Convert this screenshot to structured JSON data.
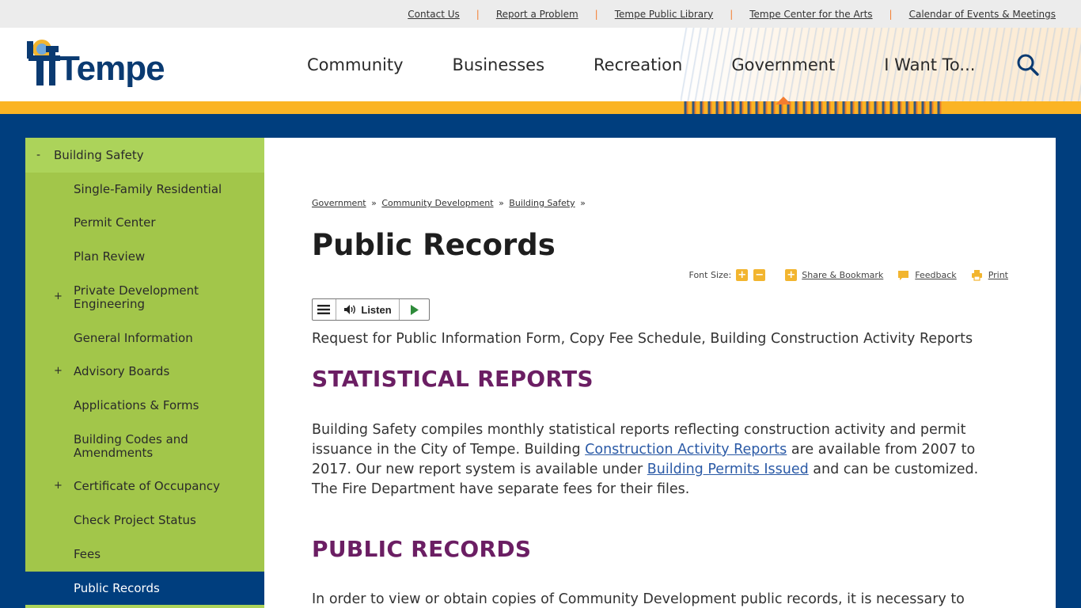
{
  "utility_nav": [
    "Contact Us",
    "Report a Problem",
    "Tempe Public Library",
    "Tempe Center for the Arts",
    "Calendar of Events & Meetings"
  ],
  "logo": {
    "text": "Tempe"
  },
  "main_nav": [
    "Community",
    "Businesses",
    "Recreation",
    "Government",
    "I Want To..."
  ],
  "active_nav": "Government",
  "sidebar": {
    "parent": {
      "toggle": "-",
      "label": "Building Safety"
    },
    "items": [
      {
        "label": "Single-Family Residential",
        "expand": ""
      },
      {
        "label": "Permit Center",
        "expand": ""
      },
      {
        "label": "Plan Review",
        "expand": ""
      },
      {
        "label": "Private Development Engineering",
        "expand": "+"
      },
      {
        "label": "General Information",
        "expand": ""
      },
      {
        "label": "Advisory Boards",
        "expand": "+"
      },
      {
        "label": "Applications & Forms",
        "expand": ""
      },
      {
        "label": "Building Codes and Amendments",
        "expand": ""
      },
      {
        "label": "Certificate of Occupancy",
        "expand": "+"
      },
      {
        "label": "Check Project Status",
        "expand": ""
      },
      {
        "label": "Fees",
        "expand": ""
      },
      {
        "label": "Public Records",
        "expand": ""
      }
    ]
  },
  "breadcrumb": {
    "items": [
      "Government",
      "Community Development",
      "Building Safety"
    ],
    "sep": "»"
  },
  "page_title": "Public Records",
  "tools": {
    "font_size_label": "Font Size:",
    "increase": "+",
    "decrease": "−",
    "share": "Share & Bookmark",
    "feedback": "Feedback",
    "print": "Print"
  },
  "listen": {
    "label": "Listen"
  },
  "intro": "Request for Public Information Form, Copy Fee Schedule, Building Construction Activity Reports",
  "section1": {
    "heading": "STATISTICAL REPORTS",
    "p1": "Building Safety compiles monthly statistical reports reflecting construction activity and permit issuance in the City of Tempe. Building ",
    "link1": "Construction Activity Reports",
    "p2": " are available from 2007 to 2017.   Our new report system is available under ",
    "link2": "Building Permits Issued",
    "p3": " and can be customized.  The Fire Department have separate fees for their files."
  },
  "section2": {
    "heading": "PUBLIC RECORDS",
    "p1": "In order to view or obtain copies of Community Development public records, it is necessary to"
  },
  "colors": {
    "navy": "#003e7e",
    "gold": "#fbb424",
    "orange": "#f47d30",
    "sidebar_green": "#a2c64a",
    "heading_purple": "#6b1e63",
    "link_blue": "#2b5aa6"
  }
}
